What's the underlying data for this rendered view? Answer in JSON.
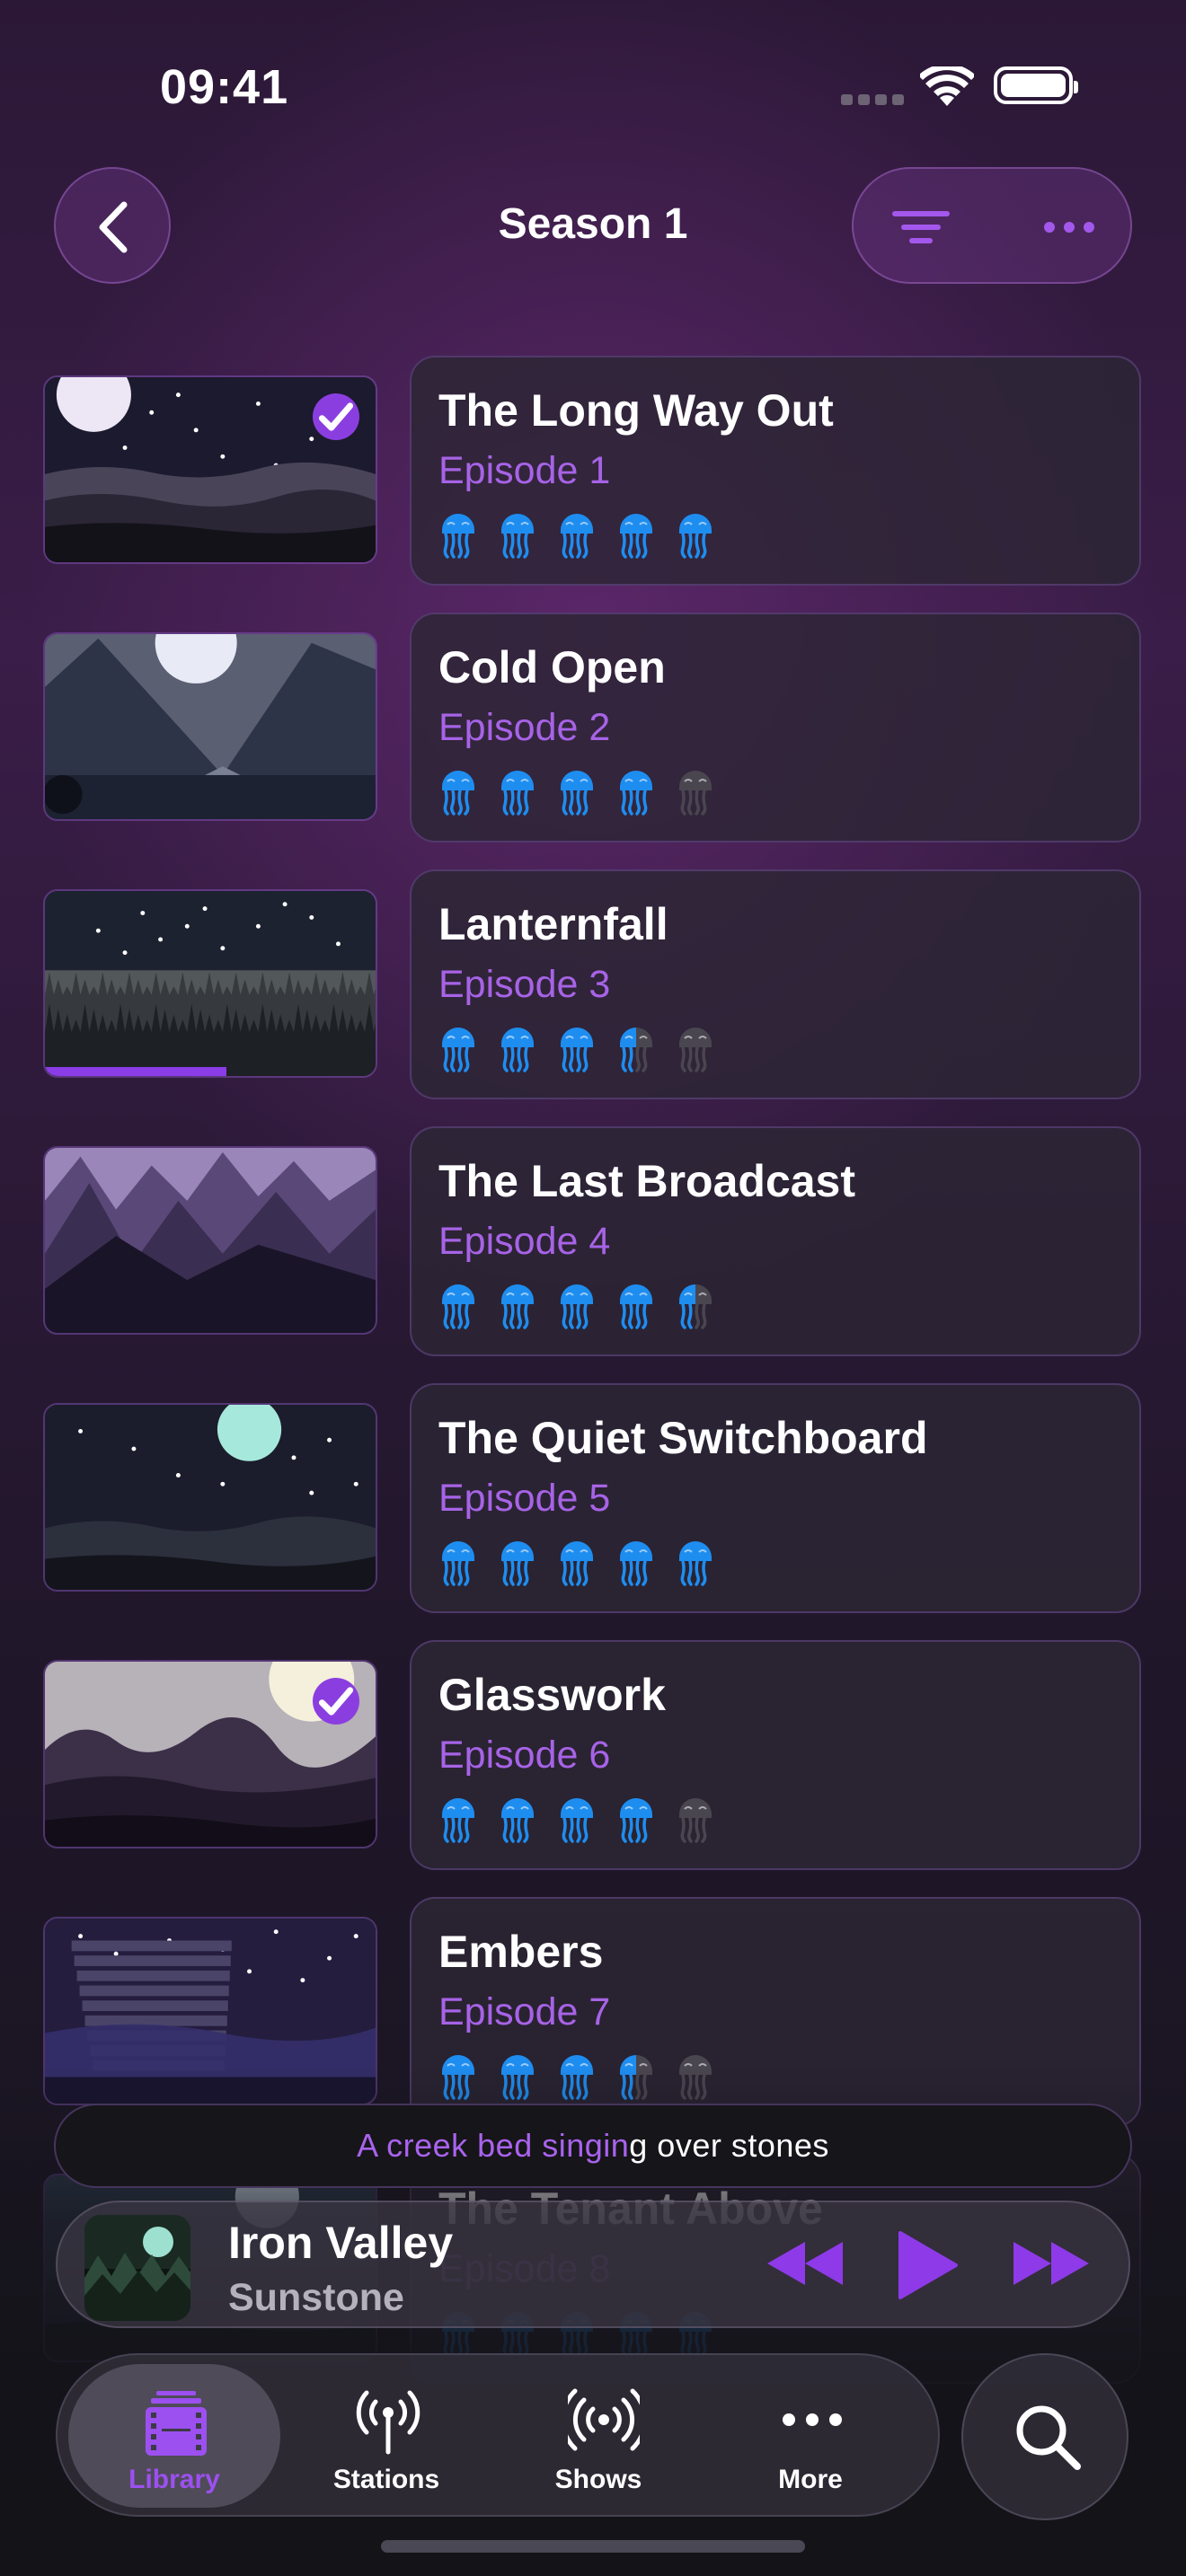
{
  "status_bar": {
    "time": "09:41"
  },
  "nav": {
    "title": "Season 1",
    "back_icon": "chevron-left-icon",
    "filter_icon": "filter-icon",
    "more_icon": "ellipsis-icon"
  },
  "colors": {
    "accent": "#8b3ee0",
    "accent_text": "#a763e6",
    "rating_on": "#1e8df0",
    "rating_off": "#4a4650"
  },
  "episodes": [
    {
      "title": "The Long Way Out",
      "episode": "Episode 1",
      "rating": 5,
      "watched": true,
      "progress": 0
    },
    {
      "title": "Cold Open",
      "episode": "Episode 2",
      "rating": 4,
      "watched": false,
      "progress": 0
    },
    {
      "title": "Lanternfall",
      "episode": "Episode 3",
      "rating": 3.5,
      "watched": false,
      "progress": 0.55
    },
    {
      "title": "The Last Broadcast",
      "episode": "Episode 4",
      "rating": 4.5,
      "watched": false,
      "progress": 0
    },
    {
      "title": "The Quiet Switchboard",
      "episode": "Episode 5",
      "rating": 5,
      "watched": false,
      "progress": 0
    },
    {
      "title": "Glasswork",
      "episode": "Episode 6",
      "rating": 4,
      "watched": true,
      "progress": 0
    },
    {
      "title": "Embers",
      "episode": "Episode 7",
      "rating": 3.5,
      "watched": false,
      "progress": 0
    },
    {
      "title": "The Tenant Above",
      "episode": "Episode 8",
      "rating": 5,
      "watched": false,
      "progress": 0
    }
  ],
  "lyrics": {
    "sung": "A creek bed singin",
    "unsung": "g over stones"
  },
  "now_playing": {
    "title": "Iron Valley",
    "artist": "Sunstone",
    "rewind_icon": "rewind-icon",
    "play_icon": "play-icon",
    "forward_icon": "fast-forward-icon"
  },
  "tabs": [
    {
      "label": "Library",
      "icon": "film-library-icon",
      "active": true
    },
    {
      "label": "Stations",
      "icon": "antenna-icon",
      "active": false
    },
    {
      "label": "Shows",
      "icon": "broadcast-icon",
      "active": false
    },
    {
      "label": "More",
      "icon": "ellipsis-icon",
      "active": false
    }
  ],
  "search": {
    "icon": "search-icon"
  }
}
